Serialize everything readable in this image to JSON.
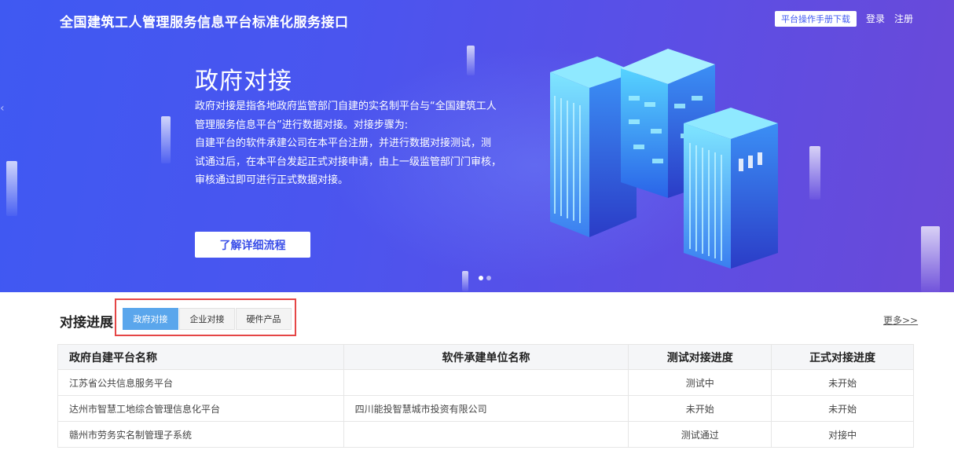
{
  "header": {
    "site_title": "全国建筑工人管理服务信息平台标准化服务接口",
    "manual_download_label": "平台操作手册下载",
    "login_label": "登录",
    "register_label": "注册"
  },
  "banner": {
    "heading": "政府对接",
    "description": "政府对接是指各地政府监管部门自建的实名制平台与“全国建筑工人管理服务信息平台”进行数据对接。对接步骤为：自建平台的软件承建公司在本平台注册，并进行数据对接测试，测试通过后，在本平台发起正式对接申请，由上一级监管部门门审核，审核通过即可进行正式数据对接。",
    "description_lines": [
      "政府对接是指各地政府监管部门自建的实名制平台与“全国建筑工人",
      "管理服务信息平台”进行数据对接。对接步骤为:",
      "自建平台的软件承建公司在本平台注册，并进行数据对接测试，测",
      "试通过后，在本平台发起正式对接申请，由上一级监管部门门审核，",
      "审核通过即可进行正式数据对接。"
    ],
    "detail_button_label": "了解详细流程",
    "prev_arrow": "‹",
    "carousel_dots": 2,
    "active_dot": 0,
    "gradient_colors": [
      "#3f59f2",
      "#6a49d8"
    ]
  },
  "progress": {
    "section_title": "对接进展",
    "tabs": [
      {
        "label": "政府对接",
        "active": true
      },
      {
        "label": "企业对接",
        "active": false
      },
      {
        "label": "硬件产品",
        "active": false
      }
    ],
    "more_label": "更多>>",
    "highlight_color": "#e54646",
    "active_tab_color": "#5aa6ec"
  },
  "table": {
    "columns": [
      "政府自建平台名称",
      "软件承建单位名称",
      "测试对接进度",
      "正式对接进度"
    ],
    "rows": [
      [
        "江苏省公共信息服务平台",
        "",
        "测试中",
        "未开始"
      ],
      [
        "达州市智慧工地综合管理信息化平台",
        "四川能投智慧城市投资有限公司",
        "未开始",
        "未开始"
      ],
      [
        "赣州市劳务实名制管理子系统",
        "",
        "测试通过",
        "对接中"
      ]
    ]
  }
}
